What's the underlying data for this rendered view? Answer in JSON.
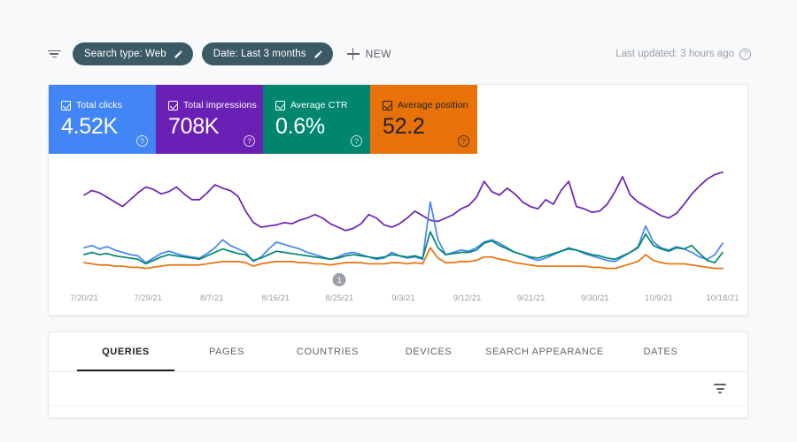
{
  "toolbar": {
    "filter_icon": "filter-icon",
    "chips": [
      {
        "label": "Search type: Web",
        "edit_icon": "pencil-icon"
      },
      {
        "label": "Date: Last 3 months",
        "edit_icon": "pencil-icon"
      }
    ],
    "new_label": "NEW",
    "new_icon": "plus-icon",
    "last_updated": "Last updated: 3 hours ago",
    "help_icon": "help-circle-icon"
  },
  "metrics": [
    {
      "label": "Total clicks",
      "value": "4.52K",
      "color": "#4285f4",
      "text": "light",
      "checked": true,
      "help_icon": "help-circle-icon"
    },
    {
      "label": "Total impressions",
      "value": "708K",
      "color": "#6a1fb5",
      "text": "light",
      "checked": true,
      "help_icon": "help-circle-icon"
    },
    {
      "label": "Average CTR",
      "value": "0.6%",
      "color": "#00866e",
      "text": "light",
      "checked": true,
      "help_icon": "help-circle-icon"
    },
    {
      "label": "Average position",
      "value": "52.2",
      "color": "#e8710a",
      "text": "dark",
      "checked": true,
      "help_icon": "help-circle-icon"
    }
  ],
  "annotation": {
    "badge_label": "1",
    "at_date": "8/25/21"
  },
  "tabs": [
    {
      "label": "QUERIES",
      "active": true
    },
    {
      "label": "PAGES",
      "active": false
    },
    {
      "label": "COUNTRIES",
      "active": false
    },
    {
      "label": "DEVICES",
      "active": false
    },
    {
      "label": "SEARCH APPEARANCE",
      "active": false
    },
    {
      "label": "DATES",
      "active": false
    }
  ],
  "table_tools": {
    "sort_icon": "sort-filter-icon"
  },
  "chart_data": {
    "type": "line",
    "title": "",
    "xlabel": "",
    "ylabel": "",
    "grid": false,
    "legend": "metric-cards-above",
    "tick_labels": [
      "7/20/21",
      "7/29/21",
      "8/7/21",
      "8/16/21",
      "8/25/21",
      "9/3/21",
      "9/12/21",
      "9/21/21",
      "9/30/21",
      "10/9/21",
      "10/18/21"
    ],
    "x_range": [
      "7/20/21",
      "10/18/21"
    ],
    "series": [
      {
        "name": "Total impressions",
        "color": "#6a1fb5",
        "values": [
          72,
          76,
          74,
          70,
          66,
          62,
          68,
          74,
          79,
          77,
          73,
          75,
          79,
          73,
          68,
          68,
          74,
          81,
          78,
          76,
          71,
          58,
          48,
          44,
          45,
          46,
          48,
          47,
          50,
          52,
          55,
          52,
          47,
          44,
          41,
          43,
          47,
          55,
          52,
          46,
          44,
          47,
          52,
          58,
          54,
          50,
          49,
          52,
          55,
          60,
          63,
          70,
          84,
          75,
          72,
          78,
          73,
          66,
          62,
          60,
          68,
          64,
          76,
          84,
          62,
          60,
          57,
          58,
          64,
          75,
          88,
          72,
          66,
          62,
          58,
          54,
          52,
          56,
          64,
          73,
          80,
          86,
          90,
          92
        ]
      },
      {
        "name": "Total clicks",
        "color": "#4285f4",
        "values": [
          26,
          28,
          25,
          27,
          24,
          22,
          20,
          19,
          13,
          17,
          21,
          23,
          21,
          19,
          18,
          17,
          21,
          26,
          33,
          28,
          25,
          22,
          14,
          18,
          25,
          31,
          29,
          27,
          25,
          22,
          20,
          18,
          16,
          18,
          21,
          22,
          20,
          18,
          16,
          17,
          22,
          19,
          17,
          18,
          16,
          66,
          33,
          20,
          22,
          24,
          23,
          26,
          31,
          33,
          30,
          26,
          22,
          20,
          17,
          15,
          17,
          20,
          23,
          26,
          24,
          21,
          19,
          17,
          15,
          14,
          18,
          22,
          27,
          45,
          31,
          26,
          24,
          27,
          25,
          22,
          18,
          16,
          20,
          30
        ]
      },
      {
        "name": "Average CTR",
        "color": "#00866e",
        "values": [
          20,
          22,
          20,
          21,
          19,
          18,
          17,
          16,
          12,
          15,
          18,
          20,
          19,
          18,
          17,
          16,
          19,
          22,
          25,
          23,
          21,
          20,
          15,
          17,
          20,
          23,
          22,
          21,
          20,
          19,
          18,
          17,
          16,
          17,
          19,
          20,
          19,
          18,
          17,
          18,
          20,
          19,
          18,
          19,
          17,
          40,
          26,
          20,
          21,
          22,
          22,
          24,
          30,
          32,
          28,
          25,
          22,
          20,
          18,
          17,
          19,
          21,
          23,
          25,
          24,
          22,
          20,
          19,
          17,
          16,
          19,
          22,
          26,
          38,
          28,
          25,
          23,
          26,
          25,
          28,
          21,
          15,
          13,
          22
        ]
      },
      {
        "name": "Average position",
        "color": "#e8710a",
        "values": [
          13,
          12,
          11,
          11,
          10,
          10,
          9,
          9,
          8,
          9,
          10,
          11,
          11,
          11,
          11,
          11,
          12,
          13,
          14,
          14,
          14,
          13,
          10,
          12,
          13,
          14,
          14,
          14,
          13,
          13,
          12,
          12,
          11,
          12,
          13,
          13,
          13,
          12,
          12,
          12,
          13,
          13,
          12,
          13,
          12,
          26,
          17,
          13,
          13,
          14,
          14,
          15,
          18,
          18,
          16,
          15,
          13,
          12,
          11,
          10,
          10,
          10,
          10,
          10,
          10,
          10,
          9,
          9,
          8,
          8,
          10,
          12,
          14,
          20,
          15,
          13,
          12,
          12,
          12,
          11,
          10,
          9,
          8,
          8
        ]
      }
    ]
  }
}
